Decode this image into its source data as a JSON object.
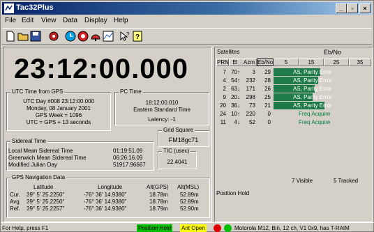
{
  "window": {
    "title": "Tac32Plus"
  },
  "menu": [
    "File",
    "Edit",
    "View",
    "Data",
    "Display",
    "Help"
  ],
  "toolbar_icons": [
    "new-icon",
    "open-icon",
    "save-icon",
    "settings-icon",
    "clock-icon",
    "satellite-icon",
    "antenna-icon",
    "chart-icon",
    "whats-this-icon",
    "help-icon"
  ],
  "clock": {
    "time": "23:12:00.000"
  },
  "utc_gps": {
    "title": "UTC Time from GPS",
    "lines": [
      "UTC Day #008 23:12:00.000",
      "Monday, 08 January 2001",
      "GPS Week = 1096",
      "UTC = GPS + 13 seconds"
    ]
  },
  "pc_time": {
    "title": "PC Time",
    "time": "18:12:00.010",
    "zone": "Eastern Standard Time",
    "latency": "Latency: -1"
  },
  "grid_square": {
    "title": "Grid Square",
    "value": "FM18gc71"
  },
  "tic": {
    "title": "TIC (usec)",
    "value": "22.4041"
  },
  "sidereal": {
    "title": "Sidereal Time",
    "rows": [
      {
        "label": "Local Mean Sidereal Time",
        "value": "01:19:51.09"
      },
      {
        "label": "Greenwich Mean Sidereal Time",
        "value": "06:26:16.09"
      },
      {
        "label": "Modified Julian Day",
        "value": "51917.96667"
      }
    ]
  },
  "nav": {
    "title": "GPS Navigation Data",
    "headers": [
      "Latitude",
      "Longitude",
      "Alt(GPS)",
      "Alt(MSL)"
    ],
    "rows": [
      {
        "label": "Cur.",
        "lat": "39°  5' 25.2250\"",
        "lon": "-76° 36' 14.9380\"",
        "alt_gps": "18.78m",
        "alt_msl": "52.89m"
      },
      {
        "label": "Avg.",
        "lat": "39°  5' 25.2250\"",
        "lon": "-76° 36' 14.9380\"",
        "alt_gps": "18.78m",
        "alt_msl": "52.89m"
      },
      {
        "label": "Ref.",
        "lat": "39°  5' 25.2257\"",
        "lon": "-76° 36' 14.9380\"",
        "alt_gps": "18.79m",
        "alt_msl": "52.90m"
      }
    ]
  },
  "satellites": {
    "title": "Satellites",
    "ebno_title": "Eb/No",
    "headers": [
      "PRN",
      "El",
      "Azm",
      "Eb/No"
    ],
    "scale": [
      "5",
      "15",
      "25",
      "35"
    ],
    "rows": [
      {
        "prn": "7",
        "el": "70",
        "dir": "↑",
        "azm": "3",
        "ebno": "29",
        "status": "AS, Parity Error",
        "fill": 0.48
      },
      {
        "prn": "4",
        "el": "54",
        "dir": "↑",
        "azm": "232",
        "ebno": "28",
        "status": "AS, Parity Error",
        "fill": 0.46
      },
      {
        "prn": "2",
        "el": "63",
        "dir": "↓",
        "azm": "171",
        "ebno": "26",
        "status": "AS, Parity Error",
        "fill": 0.42
      },
      {
        "prn": "9",
        "el": "20",
        "dir": "↓",
        "azm": "298",
        "ebno": "25",
        "status": "AS, Parity Error",
        "fill": 0.4
      },
      {
        "prn": "20",
        "el": "36",
        "dir": "↓",
        "azm": "73",
        "ebno": "21",
        "status": "AS, Parity Error",
        "fill": 0.52
      },
      {
        "prn": "24",
        "el": "10",
        "dir": "↑",
        "azm": "220",
        "ebno": "0",
        "status": "Freq Acquire",
        "fill": 0
      },
      {
        "prn": "11",
        "el": "4",
        "dir": "↓",
        "azm": "52",
        "ebno": "0",
        "status": "Freq Acquire",
        "fill": 0
      }
    ],
    "visible": "7 Visible",
    "tracked": "5 Tracked",
    "mode": "Position Hold"
  },
  "status": {
    "help": "For Help, press F1",
    "position_hold": "Position Hold",
    "ant_open": "Ant Open",
    "receiver": "Motorola M12, Bin, 12 ch, V1 0x9, has T-RAIM",
    "colors": {
      "position_hold_bg": "#00c000",
      "ant_open_bg": "#ffff00",
      "red": "#e00000",
      "green": "#00c000"
    }
  }
}
